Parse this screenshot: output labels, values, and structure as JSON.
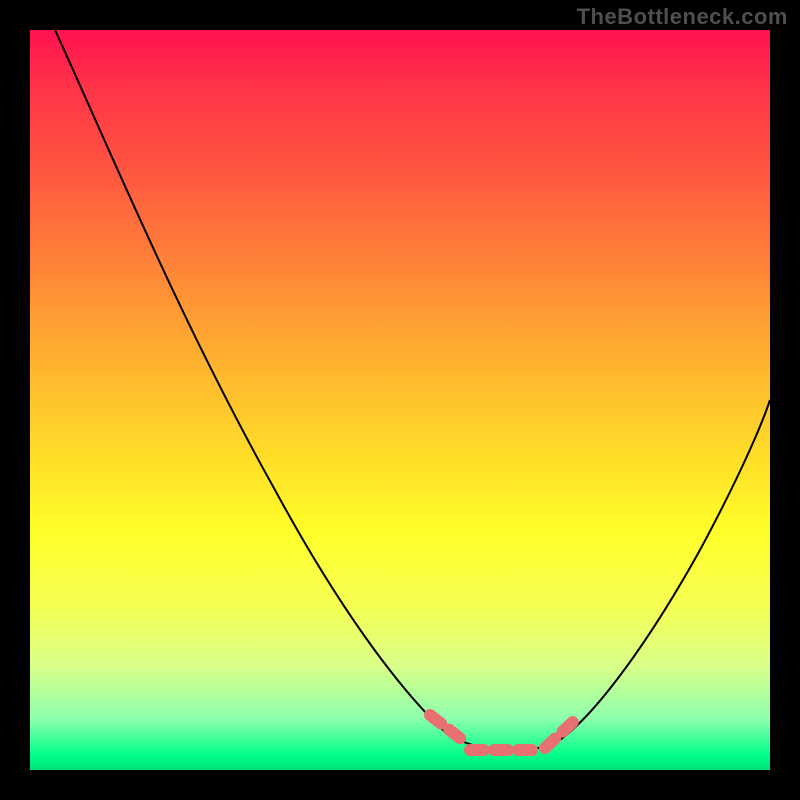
{
  "watermark": "TheBottleneck.com",
  "chart_data": {
    "type": "line",
    "title": "",
    "xlabel": "",
    "ylabel": "",
    "xlim": [
      0,
      100
    ],
    "ylim": [
      0,
      100
    ],
    "background_gradient": {
      "stops": [
        {
          "pos": 0,
          "color": "#ff1250"
        },
        {
          "pos": 30,
          "color": "#ff8d37"
        },
        {
          "pos": 60,
          "color": "#ffea28"
        },
        {
          "pos": 85,
          "color": "#ccff7a"
        },
        {
          "pos": 100,
          "color": "#00ff8a"
        }
      ]
    },
    "series": [
      {
        "name": "curve",
        "x": [
          0,
          10,
          20,
          30,
          40,
          48,
          55,
          62,
          68,
          72,
          80,
          88,
          95,
          100
        ],
        "y": [
          100,
          88,
          74,
          60,
          45,
          30,
          17,
          6,
          1,
          1,
          8,
          22,
          38,
          50
        ]
      }
    ],
    "highlight_segment": {
      "x_start": 55,
      "x_end": 72,
      "note": "flat optimum region, drawn as dashed salmon segment near y≈0–5"
    }
  }
}
